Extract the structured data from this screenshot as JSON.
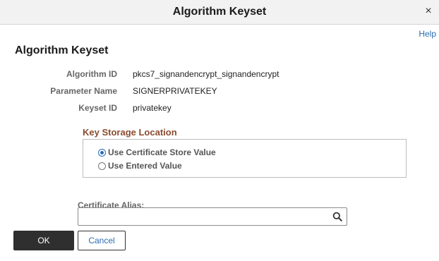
{
  "dialog": {
    "title": "Algorithm Keyset",
    "close_symbol": "×",
    "help_label": "Help"
  },
  "page_title": "Algorithm Keyset",
  "fields": [
    {
      "label": "Algorithm ID",
      "value": "pkcs7_signandencrypt_signandencrypt"
    },
    {
      "label": "Parameter Name",
      "value": "SIGNERPRIVATEKEY"
    },
    {
      "label": "Keyset ID",
      "value": "privatekey"
    }
  ],
  "key_storage": {
    "title": "Key Storage Location",
    "options": [
      {
        "label": "Use Certificate Store Value",
        "selected": true
      },
      {
        "label": "Use Entered Value",
        "selected": false
      }
    ]
  },
  "certificate_alias": {
    "label": "Certificate Alias:",
    "value": "",
    "icon": "search-icon"
  },
  "buttons": {
    "ok": "OK",
    "cancel": "Cancel"
  },
  "colors": {
    "accent": "#2b6cb0",
    "section_title": "#8a4b2e",
    "primary_button": "#2f2f2f"
  }
}
